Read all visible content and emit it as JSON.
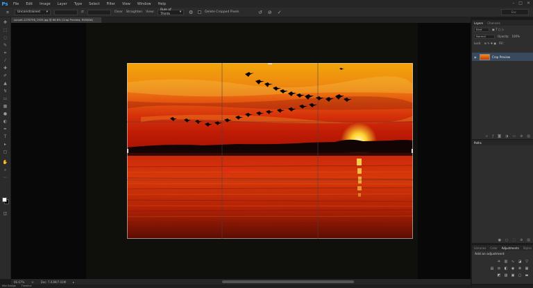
{
  "app": {
    "logo": "Ps"
  },
  "menu": [
    "File",
    "Edit",
    "Image",
    "Layer",
    "Type",
    "Select",
    "Filter",
    "View",
    "Window",
    "Help"
  ],
  "window_controls": [
    "–",
    "□",
    "×"
  ],
  "options": {
    "ratio_select": "Unconstrained",
    "swap_icon": "⇄",
    "clear_label": "Clear",
    "straighten_label": "Straighten",
    "view_label": "View:",
    "overlay_select": "Rule of Thirds",
    "delete_cropped_label": "Delete Cropped Pixels",
    "search_placeholder": "Esc"
  },
  "doc_tab": {
    "title": "sunset-1278756_1920.jpg @ 66.8% (Crop Preview, RGB/8#)"
  },
  "status": {
    "zoom": "66.67%",
    "doc": "Doc: 7.03M/7.03M"
  },
  "bottom_tabs": [
    "Mini Bridge",
    "Timeline"
  ],
  "layers_panel": {
    "tabs": [
      "Layers",
      "Channels"
    ],
    "kind_label": "Kind",
    "blend_mode": "Normal",
    "opacity_label": "Opacity:",
    "opacity_value": "100%",
    "lock_label": "Lock:",
    "fill_label": "Fill:",
    "fill_value": "",
    "layer_name": "Crop Preview"
  },
  "paths_panel": {
    "tabs": [
      "Paths"
    ]
  },
  "adjustments_panel": {
    "tabs": [
      "Libraries",
      "Color",
      "Adjustments",
      "Styles"
    ],
    "title": "Add an adjustment"
  }
}
